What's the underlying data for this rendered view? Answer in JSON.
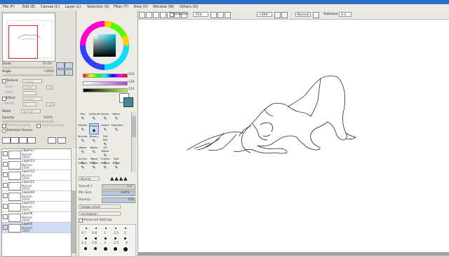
{
  "menu": [
    "File (F)",
    "Edit (E)",
    "Canvas (C)",
    "Layer (L)",
    "Selection (S)",
    "Filter (T)",
    "View (V)",
    "Window (W)",
    "Others (O)"
  ],
  "toolbar": {
    "selection_label": "Selection",
    "zoom": "75%",
    "angle": "+000°",
    "mode": "Normal",
    "stabilizer_label": "Stabilizer",
    "stabilizer": "S-2"
  },
  "navigator": {
    "zoom_label": "Zoom",
    "zoom_value": "75.0%",
    "angle_label": "Angle",
    "angle_value": "+000$"
  },
  "texture": {
    "texture_label": "Texture",
    "texture_value": "(none)",
    "scale_label": "Scale",
    "scale_value": "100%",
    "strength_label": "Stren",
    "strength_value": "20",
    "effect_label": "Effect",
    "effect_value": "(none)",
    "width_label": "Width",
    "width_value": "1",
    "width2": "100"
  },
  "layer_props": {
    "mode_label": "Mode",
    "mode_value": "Normal",
    "opacity_label": "Opacity",
    "opacity_value": "100%",
    "protect_label": "Protect Opacity",
    "clip_label": "Clipping Group",
    "source_label": "Selection Source"
  },
  "layers": [
    {
      "name": "Layer17",
      "mode": "Normal",
      "opacity": "100%"
    },
    {
      "name": "Layer13",
      "mode": "Normal",
      "opacity": "100%"
    },
    {
      "name": "Layer12",
      "mode": "Normal",
      "opacity": "100%"
    },
    {
      "name": "Layer11",
      "mode": "Normal",
      "opacity": "100%"
    },
    {
      "name": "Layer10",
      "mode": "Normal",
      "opacity": "100%"
    },
    {
      "name": "Layer15",
      "mode": "Normal",
      "opacity": "100%"
    },
    {
      "name": "Layer6",
      "mode": "Normal",
      "opacity": "100%"
    },
    {
      "name": "Layer5",
      "mode": "Normal",
      "opacity": "100%"
    }
  ],
  "color": {
    "h_value": "202",
    "s_value": "239",
    "v_value": "224",
    "hex_primary": "#3f8b94"
  },
  "tools": [
    [
      "Pen",
      "AirBrush",
      "Brush",
      "Water"
    ],
    [
      "Marker",
      "Eraser",
      "Select",
      "Deselect"
    ],
    [
      "Bucket",
      "Binary",
      "Old Pen",
      ""
    ],
    [
      "Water",
      "Water",
      "Oil Water",
      ""
    ],
    [
      "Acrylic",
      "Paper",
      "Crayon",
      "Blur"
    ],
    [
      "Marker",
      "Marker",
      "Marker",
      "Brush"
    ]
  ],
  "brush": {
    "mode": "Normal",
    "size_label": "Size",
    "size_mult": "x0.1",
    "size_value": "1.0",
    "min_size_label": "Min Size",
    "min_size_value": "100%",
    "density_label": "Density",
    "density_value": "100",
    "shape": "(simple circle)",
    "texture": "(no texture)",
    "advanced_label": "Advanced Settings",
    "size_presets": [
      "0.7",
      "0.8",
      "1",
      "1.5",
      "2",
      "2.3",
      "2.6",
      "3",
      "3.5",
      "4"
    ]
  }
}
